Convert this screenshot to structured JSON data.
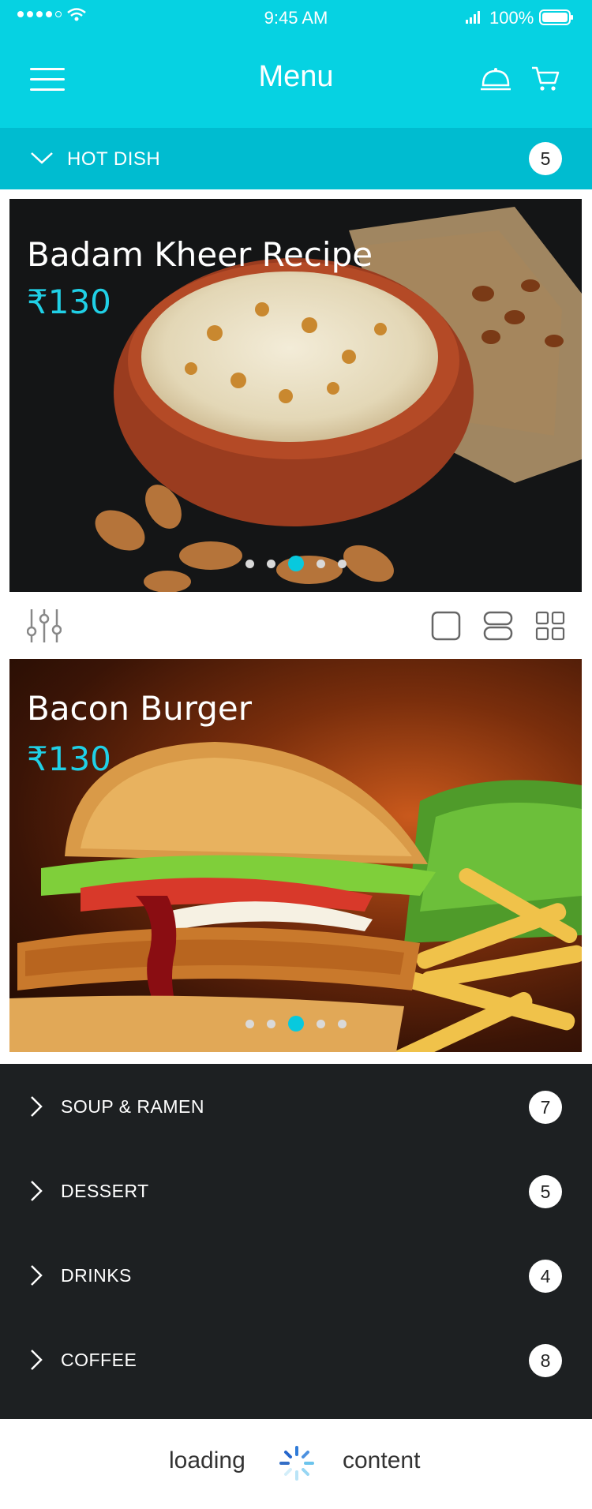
{
  "status_bar": {
    "time": "9:45 AM",
    "battery": "100%"
  },
  "header": {
    "title": "Menu",
    "icons": [
      "menu-icon",
      "cloche-icon",
      "cart-icon"
    ]
  },
  "hot_dish": {
    "label": "HOT DISH",
    "count": "5"
  },
  "cards": [
    {
      "title": "Badam Kheer Recipe",
      "price": "₹130",
      "slides": 5,
      "active_slide": 3
    },
    {
      "title": "Bacon Burger",
      "price": "₹130",
      "slides": 5,
      "active_slide": 3
    }
  ],
  "toolbar": {
    "icons": [
      "filter-icon",
      "single-view-icon",
      "list-view-icon",
      "grid-view-icon"
    ]
  },
  "categories": [
    {
      "label": "SOUP & RAMEN",
      "count": "7"
    },
    {
      "label": "DESSERT",
      "count": "5"
    },
    {
      "label": "DRINKS",
      "count": "4"
    },
    {
      "label": "COFFEE",
      "count": "8"
    }
  ],
  "loading": {
    "left": "loading",
    "right": "content"
  },
  "colors": {
    "primary": "#06D2E2",
    "secondary": "#00BCD0",
    "dark": "#1D2022",
    "price": "#20D0E6"
  }
}
